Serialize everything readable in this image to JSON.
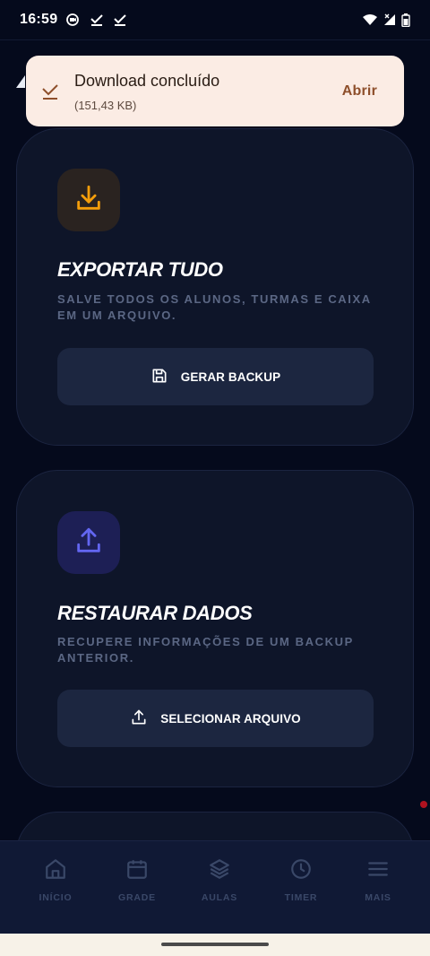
{
  "status_bar": {
    "time": "16:59",
    "left_icons": [
      "screen-record-icon",
      "check-icon",
      "check-icon"
    ],
    "right_icons": [
      "wifi-icon",
      "signal-icon",
      "battery-icon"
    ]
  },
  "toast": {
    "title": "Download concluído",
    "subtitle": "(151,43 KB)",
    "action_label": "Abrir",
    "icon": "download-done-check-icon"
  },
  "cards": {
    "export": {
      "icon": "download-icon",
      "title": "EXPORTAR TUDO",
      "description": "SALVE TODOS OS ALUNOS, TURMAS E CAIXA EM UM ARQUIVO.",
      "button_label": "GERAR BACKUP",
      "button_icon": "save-icon"
    },
    "restore": {
      "icon": "upload-icon",
      "title": "RESTAURAR DADOS",
      "description": "RECUPERE INFORMAÇÕES DE UM BACKUP ANTERIOR.",
      "button_label": "SELECIONAR ARQUIVO",
      "button_icon": "upload-icon"
    }
  },
  "bottom_nav": {
    "items": [
      {
        "label": "INÍCIO",
        "icon": "home-icon"
      },
      {
        "label": "GRADE",
        "icon": "calendar-icon"
      },
      {
        "label": "AULAS",
        "icon": "layers-icon"
      },
      {
        "label": "TIMER",
        "icon": "clock-icon"
      },
      {
        "label": "MAIS",
        "icon": "menu-icon"
      }
    ]
  },
  "colors": {
    "background": "#050a1c",
    "card": "#0e1529",
    "export_accent": "#f59e0b",
    "restore_accent": "#6366f1",
    "toast_bg": "#fbece4",
    "toast_action": "#8e4f2b",
    "nav_inactive": "#3a4868"
  }
}
